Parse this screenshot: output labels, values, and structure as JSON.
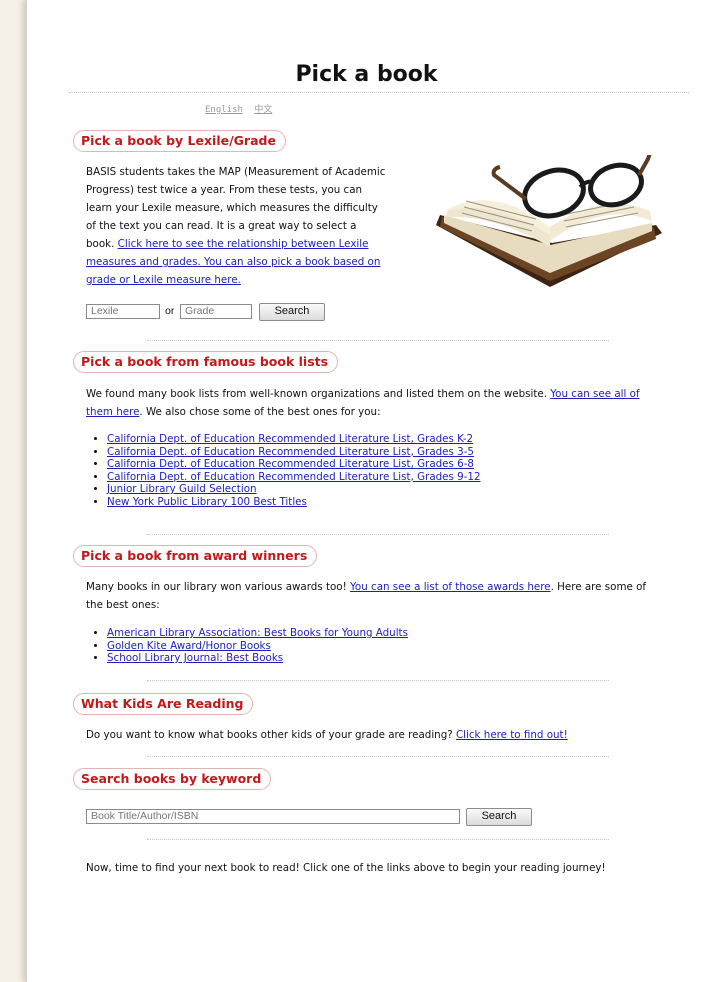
{
  "page": {
    "title": "Pick a book",
    "languages": [
      "English",
      "中文"
    ]
  },
  "lexile": {
    "heading": "Pick a book by Lexile/Grade",
    "intro": "BASIS students takes the MAP (Measurement of Academic Progress) test twice a year. From these tests, you can learn your Lexile measure, which measures the difficulty of the text you can read. It is a great way to select a book. ",
    "link": "Click here to see the relationship between Lexile measures and grades. You can also pick a book based on grade or Lexile measure here.",
    "lexile_placeholder": "Lexile",
    "or_label": "or",
    "grade_placeholder": "Grade",
    "search_label": "Search"
  },
  "famous": {
    "heading": "Pick a book from famous book lists",
    "intro": "We found many book lists from well-known organizations and listed them on the website. ",
    "link": "You can see all of them here",
    "outro": ". We also chose some of the best ones for you:",
    "items": [
      "California Dept. of Education Recommended Literature List, Grades K-2",
      "California Dept. of Education Recommended Literature List, Grades 3-5",
      "California Dept. of Education Recommended Literature List, Grades 6-8",
      "California Dept. of Education Recommended Literature List, Grades 9-12",
      "Junior Library Guild Selection",
      "New York Public Library 100 Best Titles"
    ]
  },
  "awards": {
    "heading": "Pick a book from award winners",
    "intro": "Many books in our library won various awards too! ",
    "link": "You can see a list of those awards here",
    "outro": ". Here are some of the best ones:",
    "items": [
      "American Library Association: Best Books for Young Adults",
      "Golden Kite Award/Honor Books",
      "School Library Journal: Best Books"
    ]
  },
  "kids": {
    "heading": "What Kids Are Reading",
    "intro": "Do you want to know what books other kids of your grade are reading? ",
    "link": "Click here to find out!"
  },
  "keyword": {
    "heading": "Search books by keyword",
    "placeholder": "Book Title/Author/ISBN",
    "search_label": "Search"
  },
  "footer_text": "Now, time to find your next book to read! Click one of the links above to begin your reading journey!",
  "colors": {
    "heading_text": "#c2191b",
    "heading_border": "#e2b5b0",
    "link": "#1d1dbf",
    "background": "#f6f1e8"
  },
  "icons": {
    "book_image": "open-book-with-glasses"
  }
}
